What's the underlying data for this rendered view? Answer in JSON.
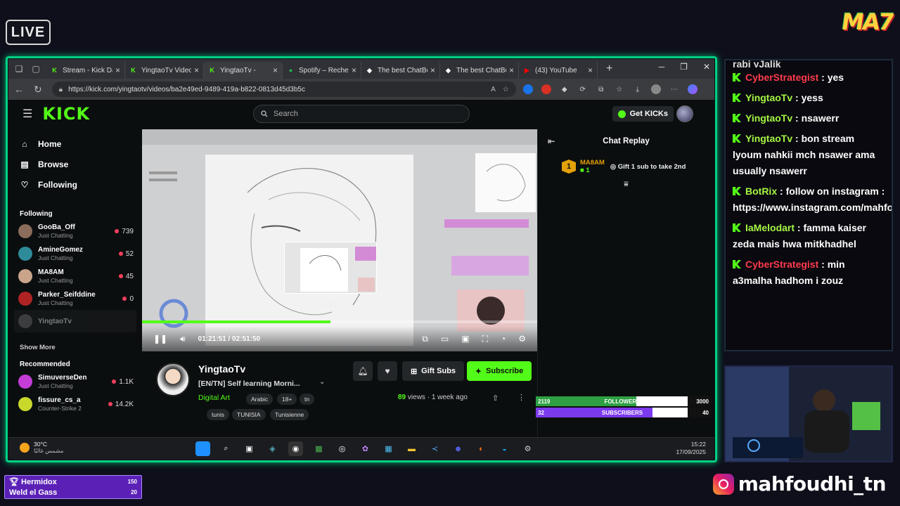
{
  "overlay": {
    "live_label": "LIVE",
    "brand_logo": "MA7",
    "social_handle": "mahfoudhi_tn",
    "social_icon": "instagram-icon",
    "supporter": {
      "name1": "Hermidox",
      "value1": "150",
      "name2": "Weld el Gass",
      "value2": "20"
    },
    "goals": [
      {
        "label": "FOLLOWERS",
        "current": "2119",
        "target": "3000",
        "progress": 0.706,
        "color": "#2ea043"
      },
      {
        "label": "SUBSCRIBERS",
        "current": "32",
        "target": "40",
        "progress": 0.8,
        "color": "#7c3aed"
      }
    ]
  },
  "browser": {
    "tabs": [
      {
        "title": "Stream - Kick Da",
        "icon": "kick-icon"
      },
      {
        "title": "YingtaoTv Videos",
        "icon": "kick-icon"
      },
      {
        "title": "YingtaoTv - ",
        "icon": "kick-icon",
        "active": true
      },
      {
        "title": "Spotify – Recherc",
        "icon": "spotify-icon"
      },
      {
        "title": "The best ChatBot",
        "icon": "botrix-icon"
      },
      {
        "title": "The best ChatBot",
        "icon": "botrix-icon"
      },
      {
        "title": "(43) YouTube",
        "icon": "youtube-icon"
      }
    ],
    "url": "https://kick.com/yingtaotv/videos/ba2e49ed-9489-419a-b822-0813d45d3b5c"
  },
  "kick": {
    "logo": "KICK",
    "search_placeholder": "Search",
    "get_kicks": "Get KICKs",
    "nav": {
      "home": "Home",
      "browse": "Browse",
      "following": "Following"
    },
    "following_header": "Following",
    "following": [
      {
        "name": "GooBa_Off",
        "category": "Just Chatting",
        "viewers": "739",
        "avatar_color": "#8a6d5a"
      },
      {
        "name": "AmineGomez",
        "category": "Just Chatting",
        "viewers": "52",
        "avatar_color": "#2e8b9a"
      },
      {
        "name": "MA8AM",
        "category": "Just Chatting",
        "viewers": "45",
        "avatar_color": "#c9a48a"
      },
      {
        "name": "Parker_Seifddine",
        "category": "Just Chatting",
        "viewers": "0",
        "avatar_color": "#b02323"
      }
    ],
    "ghost_channel": "YingtaoTv",
    "show_more": "Show More",
    "recommended_header": "Recommended",
    "recommended": [
      {
        "name": "SimuverseDen",
        "category": "Just Chatting",
        "viewers": "1.1K",
        "avatar_color": "#c43dd6"
      },
      {
        "name": "fissure_cs_a",
        "category": "Counter-Strike 2",
        "viewers": "14.2K",
        "avatar_color": "#c9d92b"
      }
    ],
    "video": {
      "current_time": "01:21:51",
      "duration": "02:51:50",
      "time_display": "01:21:51 / 02:51:50",
      "preview_time": "01:21:51",
      "progress": 0.476
    },
    "chat": {
      "title": "Chat Replay",
      "sub_level": "1",
      "sub_user": "MA8AM",
      "sub_count": "1",
      "sub_message": "Gift 1 sub to take 2nd"
    },
    "channel": {
      "name": "YingtaoTv",
      "stream_title": "[EN/TN] Self learning Morni...",
      "category": "Digital Art",
      "tags_row1": [
        "Arabic",
        "18+",
        "tn"
      ],
      "tags_row2": [
        "tunis",
        "TUNISIA",
        "Tunisienne"
      ],
      "gift_label": "Gift Subs",
      "subscribe_label": "Subscribe",
      "views": "89",
      "views_label": "views",
      "age": "1 week ago"
    }
  },
  "taskbar": {
    "temp": "30°C",
    "weather_text": "مشمس غالبًا",
    "time": "15:22",
    "date": "17/09/2025"
  },
  "stream_chat": {
    "partial_top": "rabi yJalik",
    "messages": [
      {
        "user": "CyberStrategist",
        "color": "red",
        "text": ": yes"
      },
      {
        "user": "YingtaoTv",
        "color": "green",
        "text": ": yess"
      },
      {
        "user": "YingtaoTv",
        "color": "green",
        "text": ": nsawerr"
      },
      {
        "user": "YingtaoTv",
        "color": "green",
        "text": ": bon stream lyoum nahkii mch nsawer ama usually nsawerr"
      },
      {
        "user": "BotRix",
        "color": "green",
        "text": ": follow on instagram : https://www.instagram.com/mahfoudhi_tn/"
      },
      {
        "user": "IaMelodart",
        "color": "green",
        "text": ": famma kaiser zeda mais hwa mitkhadhel"
      },
      {
        "user": "CyberStrategist",
        "color": "red",
        "text": ": min a3malha hadhom i zouz"
      }
    ]
  }
}
